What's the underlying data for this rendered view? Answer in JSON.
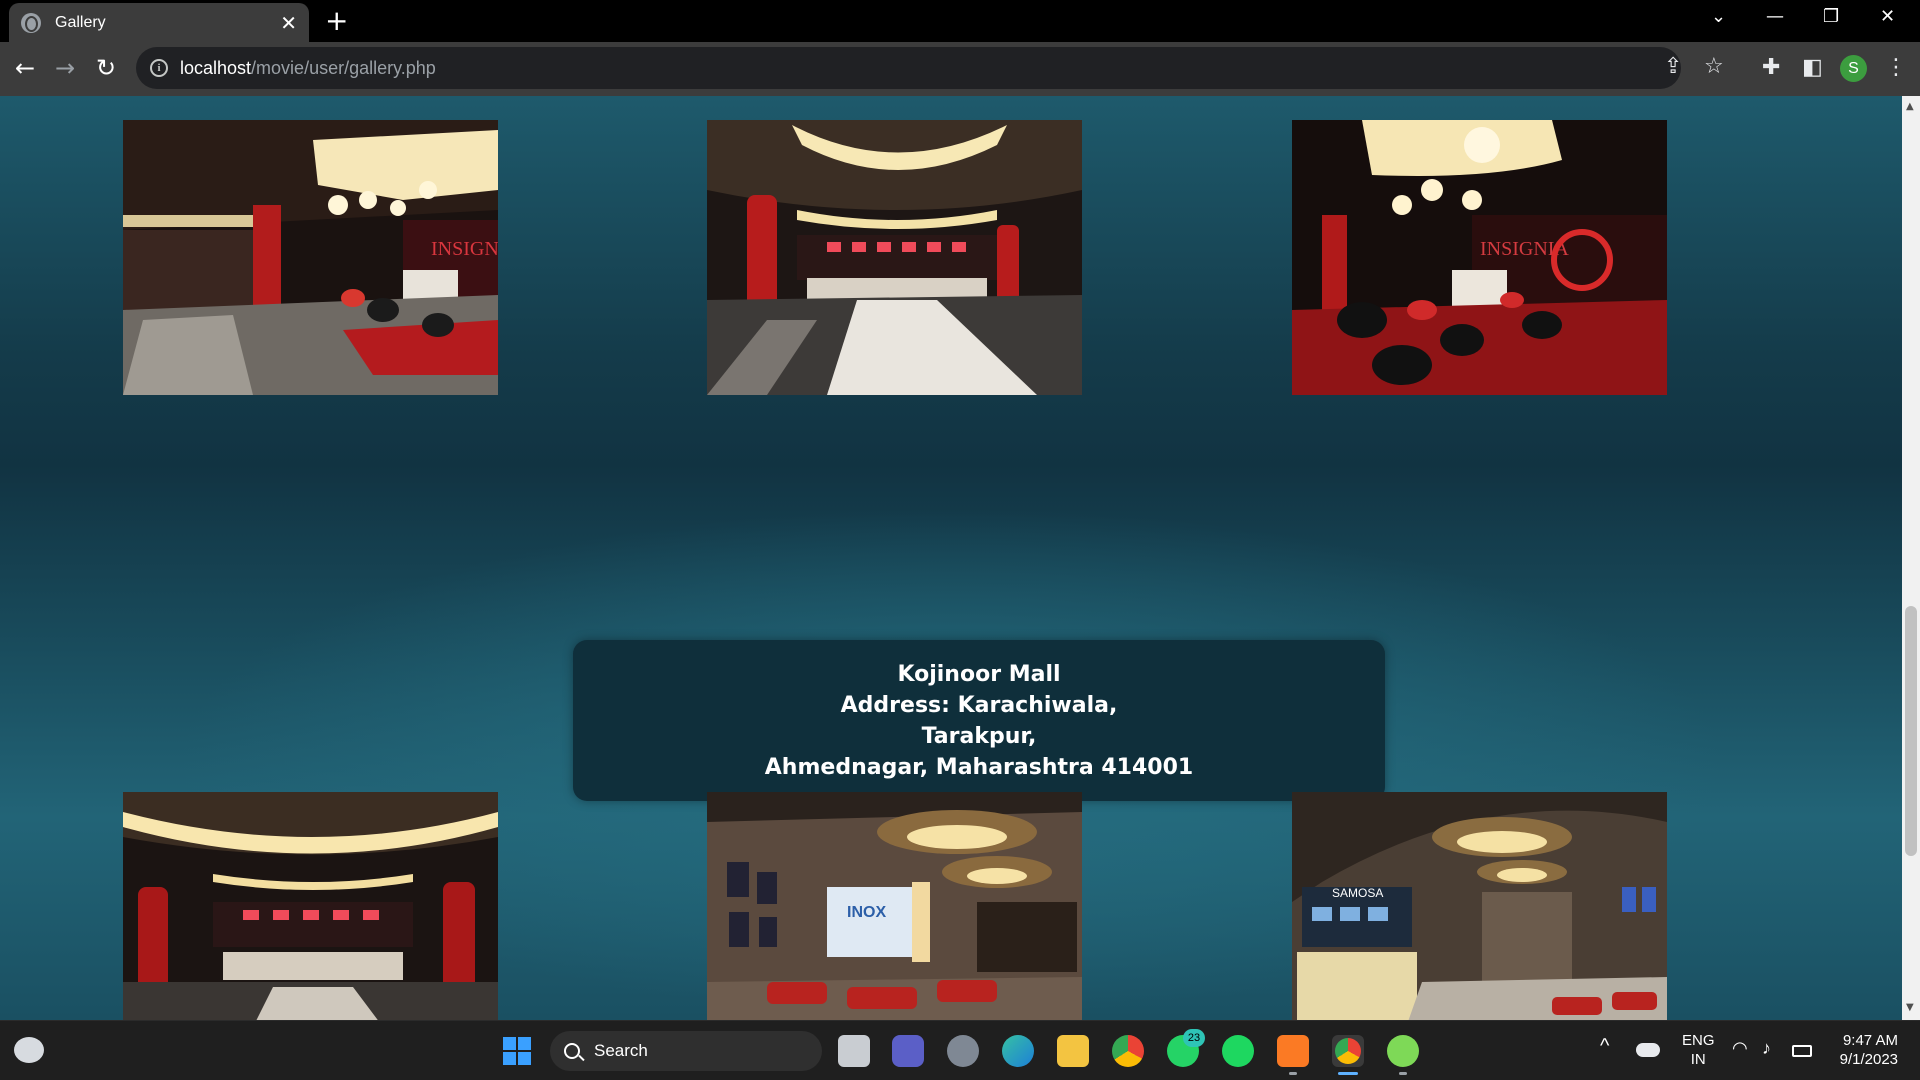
{
  "browser": {
    "tab_title": "Gallery",
    "tab_close": "✕",
    "new_tab": "+",
    "url_host": "localhost",
    "url_path": "/movie/user/gallery.php",
    "profile_initial": "S"
  },
  "icons": {
    "back": "←",
    "forward": "→",
    "reload": "↻",
    "share": "⇪",
    "star": "☆",
    "extensions": "✚",
    "sidepanel": "◧",
    "menu": "⋮",
    "minimize": "—",
    "restore": "❐",
    "close": "✕",
    "tab_search": "⌄",
    "info": "i"
  },
  "gallery": {
    "top_row": [
      "lobby-photo-1",
      "lobby-photo-2",
      "lobby-photo-3"
    ],
    "bottom_row": [
      "lobby-photo-4",
      "lobby-photo-5",
      "lobby-photo-6"
    ]
  },
  "info_box": {
    "name": "Kojinoor Mall",
    "address_line1": "Address: Karachiwala,",
    "address_line2": "Tarakpur,",
    "address_line3": "Ahmednagar, Maharashtra 414001"
  },
  "taskbar": {
    "search_placeholder": "Search",
    "whatsapp_badge": "23",
    "lang_line1": "ENG",
    "lang_line2": "IN",
    "time": "9:47 AM",
    "date": "9/1/2023"
  },
  "colors": {
    "page_teal": "#1e5a6c",
    "info_box_bg": "#0f2f3b",
    "chrome_toolbar": "#3c3c3c"
  }
}
